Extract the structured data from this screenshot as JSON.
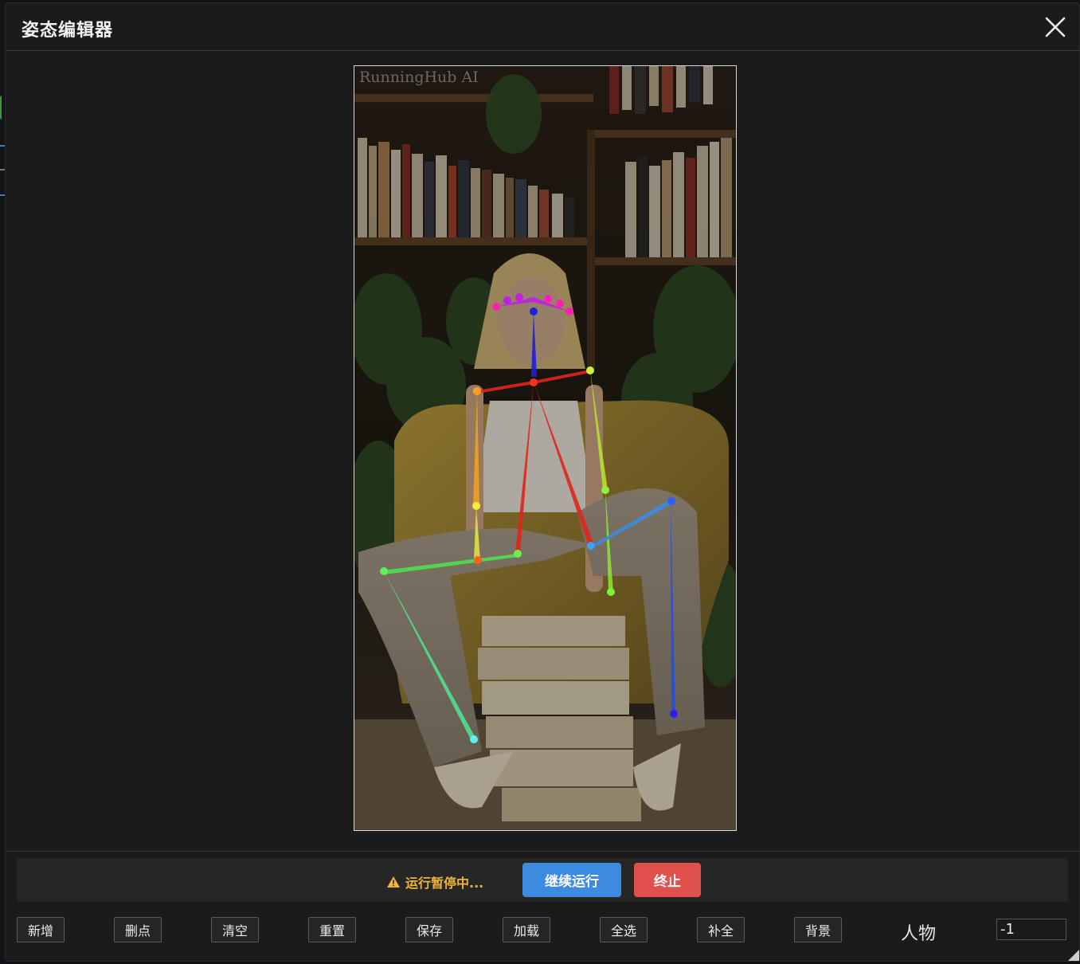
{
  "dialog": {
    "title": "姿态编辑器"
  },
  "canvas": {
    "watermark": "RunningHub AI"
  },
  "status": {
    "message": "运行暂停中...",
    "continue_label": "继续运行",
    "stop_label": "终止",
    "warning_color": "#f0b43a"
  },
  "toolbar": {
    "buttons": [
      "新增",
      "删点",
      "清空",
      "重置",
      "保存",
      "加载",
      "全选",
      "补全",
      "背景"
    ],
    "person_label": "人物",
    "person_value": "-1"
  },
  "colors": {
    "accent_blue": "#3d8be0",
    "danger_red": "#e0504c"
  }
}
